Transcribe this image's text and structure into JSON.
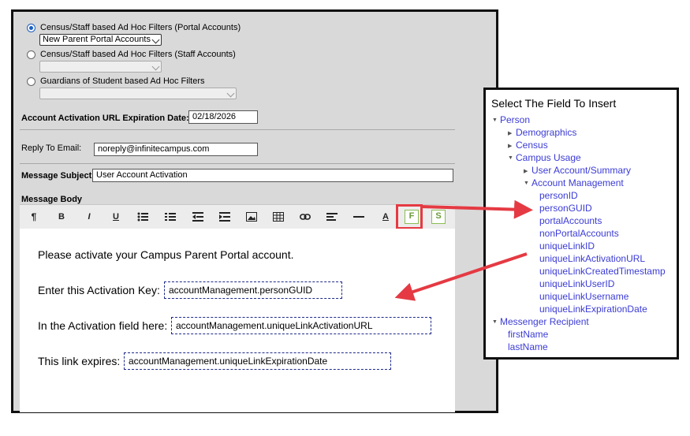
{
  "filters": {
    "portal": {
      "label": "Census/Staff based Ad Hoc Filters (Portal Accounts)",
      "selected": "New Parent Portal Accounts",
      "checked": true
    },
    "staff": {
      "label": "Census/Staff based Ad Hoc Filters (Staff Accounts)",
      "selected": "",
      "checked": false
    },
    "guardians": {
      "label": "Guardians of Student based Ad Hoc Filters",
      "selected": "",
      "checked": false
    }
  },
  "expiration": {
    "label": "Account Activation URL Expiration Date:",
    "value": "02/18/2026"
  },
  "reply_to": {
    "label": "Reply To Email:",
    "value": "noreply@infinitecampus.com"
  },
  "subject": {
    "label": "Message Subject",
    "value": "User Account Activation"
  },
  "body": {
    "label": "Message Body",
    "toolbar": {
      "bold": "B",
      "italic": "I",
      "underline": "U",
      "text_color": "A",
      "field": "F",
      "sql": "S"
    },
    "line1": "Please activate your Campus Parent Portal account.",
    "line2_label": "Enter this Activation Key:",
    "line2_token": "accountManagement.personGUID",
    "line3_label": "In the Activation field here:",
    "line3_token": "accountManagement.uniqueLinkActivationURL",
    "line4_label": "This link expires:",
    "line4_token": "accountManagement.uniqueLinkExpirationDate"
  },
  "tree": {
    "title": "Select The Field To Insert",
    "person": "Person",
    "demographics": "Demographics",
    "census": "Census",
    "campus_usage": "Campus Usage",
    "user_account": "User Account/Summary",
    "account_management": "Account Management",
    "fields": [
      "personID",
      "personGUID",
      "portalAccounts",
      "nonPortalAccounts",
      "uniqueLinkID",
      "uniqueLinkActivationURL",
      "uniqueLinkCreatedTimestamp",
      "uniqueLinkUserID",
      "uniqueLinkUsername",
      "uniqueLinkExpirationDate"
    ],
    "messenger_recipient": "Messenger Recipient",
    "recipient_fields": [
      "firstName",
      "lastName"
    ]
  },
  "colors": {
    "accent_red": "#e53a43",
    "link_blue": "#3b3bd6",
    "field_green": "#8bbd55"
  }
}
